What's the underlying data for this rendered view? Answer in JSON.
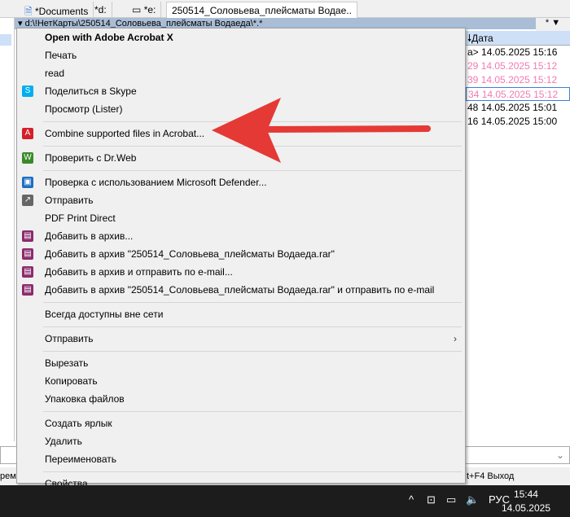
{
  "tabs": [
    {
      "label": "*Documents"
    },
    {
      "label": "*d:"
    },
    {
      "label": "*e:"
    },
    {
      "label": "250514_Соловьева_плейсматы Водае.."
    }
  ],
  "path": "d:\\!НетКарты\\250514_Соловьева_плейсматы Водаеда\\*.*",
  "path_controls": "* ▼",
  "column_header": "Дата",
  "rows": [
    {
      "size": "a>",
      "date": "14.05.2025 15:16",
      "color": "normal"
    },
    {
      "size": "29",
      "date": "14.05.2025 15:12",
      "color": "pink"
    },
    {
      "size": "39",
      "date": "14.05.2025 15:12",
      "color": "pink"
    },
    {
      "size": "34",
      "date": "14.05.2025 15:12",
      "color": "pink"
    },
    {
      "size": "48",
      "date": "14.05.2025 15:01",
      "color": "normal"
    },
    {
      "size": "16",
      "date": "14.05.2025 15:00",
      "color": "normal"
    }
  ],
  "fkeys_left": "реме",
  "fkeys_right": "t+F4 Выход",
  "menu": [
    {
      "label": "Open with Adobe Acrobat X",
      "bold": true
    },
    {
      "label": "Печать"
    },
    {
      "label": "read"
    },
    {
      "label": "Поделиться в Skype",
      "icon": "skype-icon",
      "color": "#00aff0",
      "glyph": "S"
    },
    {
      "label": "Просмотр (Lister)"
    },
    {
      "sep": true
    },
    {
      "label": "Combine supported files in Acrobat...",
      "icon": "acrobat-icon",
      "color": "#d4202a",
      "glyph": "A"
    },
    {
      "sep": true
    },
    {
      "label": "Проверить с Dr.Web",
      "icon": "drweb-icon",
      "color": "#3a8a2a",
      "glyph": "W"
    },
    {
      "sep": true
    },
    {
      "label": "Проверка с использованием Microsoft Defender...",
      "icon": "defender-icon",
      "color": "#1f6fc4",
      "glyph": "▣"
    },
    {
      "label": "Отправить",
      "icon": "share-icon",
      "color": "#666",
      "glyph": "↗"
    },
    {
      "label": "PDF Print Direct"
    },
    {
      "label": "Добавить в архив...",
      "icon": "winrar-icon",
      "color": "#8b2c6e",
      "glyph": "▤"
    },
    {
      "label": "Добавить в архив \"250514_Соловьева_плейсматы Водаеда.rar\"",
      "icon": "winrar-icon",
      "color": "#8b2c6e",
      "glyph": "▤"
    },
    {
      "label": "Добавить в архив и отправить по e-mail...",
      "icon": "winrar-icon",
      "color": "#8b2c6e",
      "glyph": "▤"
    },
    {
      "label": "Добавить в архив \"250514_Соловьева_плейсматы Водаеда.rar\" и отправить по e-mail",
      "icon": "winrar-icon",
      "color": "#8b2c6e",
      "glyph": "▤"
    },
    {
      "sep": true
    },
    {
      "label": "Всегда доступны вне сети"
    },
    {
      "sep": true
    },
    {
      "label": "Отправить",
      "submenu": true
    },
    {
      "sep": true
    },
    {
      "label": "Вырезать"
    },
    {
      "label": "Копировать"
    },
    {
      "label": "Упаковка файлов"
    },
    {
      "sep": true
    },
    {
      "label": "Создать ярлык"
    },
    {
      "label": "Удалить"
    },
    {
      "label": "Переименовать"
    },
    {
      "sep": true
    },
    {
      "label": "Свойства"
    }
  ],
  "taskbar": {
    "lang": "РУС",
    "time": "15:44",
    "date": "14.05.2025"
  },
  "annotation_color": "#e53935"
}
